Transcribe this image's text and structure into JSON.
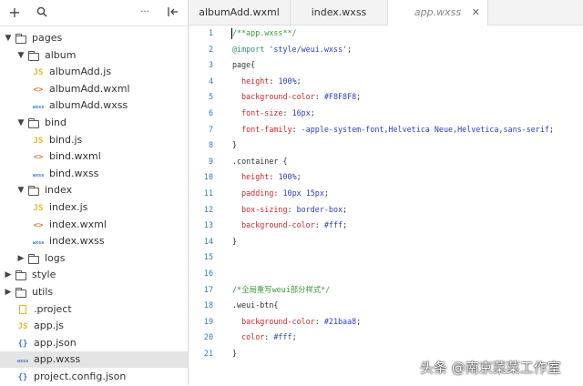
{
  "toolbar": {
    "icons": [
      "plus-icon",
      "search-icon",
      "more-icon",
      "collapse-panel-icon"
    ],
    "plus": "+",
    "more": "···"
  },
  "tree": [
    {
      "label": "pages",
      "type": "folder",
      "expanded": true,
      "depth": 0
    },
    {
      "label": "album",
      "type": "folder",
      "expanded": true,
      "depth": 1
    },
    {
      "label": "albumAdd.js",
      "type": "js",
      "depth": 2
    },
    {
      "label": "albumAdd.wxml",
      "type": "wxml",
      "depth": 2
    },
    {
      "label": "albumAdd.wxss",
      "type": "wxss",
      "depth": 2
    },
    {
      "label": "bind",
      "type": "folder",
      "expanded": true,
      "depth": 1
    },
    {
      "label": "bind.js",
      "type": "js",
      "depth": 2
    },
    {
      "label": "bind.wxml",
      "type": "wxml",
      "depth": 2
    },
    {
      "label": "bind.wxss",
      "type": "wxss",
      "depth": 2
    },
    {
      "label": "index",
      "type": "folder",
      "expanded": true,
      "depth": 1
    },
    {
      "label": "index.js",
      "type": "js",
      "depth": 2
    },
    {
      "label": "index.wxml",
      "type": "wxml",
      "depth": 2
    },
    {
      "label": "index.wxss",
      "type": "wxss",
      "depth": 2
    },
    {
      "label": "logs",
      "type": "folder",
      "expanded": false,
      "depth": 1
    },
    {
      "label": "style",
      "type": "folder",
      "expanded": false,
      "depth": 0
    },
    {
      "label": "utils",
      "type": "folder",
      "expanded": false,
      "depth": 0
    },
    {
      "label": ".project",
      "type": "file",
      "depth": 0
    },
    {
      "label": "app.js",
      "type": "js",
      "depth": 0
    },
    {
      "label": "app.json",
      "type": "json",
      "depth": 0
    },
    {
      "label": "app.wxss",
      "type": "wxss",
      "depth": 0,
      "selected": true
    },
    {
      "label": "project.config.json",
      "type": "json",
      "depth": 0
    }
  ],
  "icon_text": {
    "js": "JS",
    "wxml": "<>",
    "wxss": "wxss",
    "json": "{}"
  },
  "tabs": [
    {
      "label": "albumAdd.wxml",
      "active": false
    },
    {
      "label": "index.wxss",
      "active": false
    },
    {
      "label": "app.wxss",
      "active": true,
      "close": "✕"
    }
  ],
  "editor": {
    "colors": {
      "comment": "#3a9a3a",
      "keyword": "#3c8a7e",
      "property": "#c72a2a",
      "value": "#2d3fb3",
      "string": "#2d3fb3",
      "punct": "#333333",
      "selector": "#333333",
      "line_number": "#2b7bb9"
    },
    "lines": [
      [
        {
          "t": "/**app.wxss**/",
          "c": "comment"
        }
      ],
      [
        {
          "t": "@import",
          "c": "keyword"
        },
        {
          "t": " ",
          "c": "punct"
        },
        {
          "t": "'style/weui.wxss'",
          "c": "string"
        },
        {
          "t": ";",
          "c": "punct"
        }
      ],
      [
        {
          "t": "page{",
          "c": "selector"
        }
      ],
      [
        {
          "t": "  height",
          "c": "property"
        },
        {
          "t": ": ",
          "c": "punct"
        },
        {
          "t": "100%",
          "c": "value"
        },
        {
          "t": ";",
          "c": "punct"
        }
      ],
      [
        {
          "t": "  background-color",
          "c": "property"
        },
        {
          "t": ": ",
          "c": "punct"
        },
        {
          "t": "#F8F8F8",
          "c": "value"
        },
        {
          "t": ";",
          "c": "punct"
        }
      ],
      [
        {
          "t": "  font-size",
          "c": "property"
        },
        {
          "t": ": ",
          "c": "punct"
        },
        {
          "t": "16px",
          "c": "value"
        },
        {
          "t": ";",
          "c": "punct"
        }
      ],
      [
        {
          "t": "  font-family",
          "c": "property"
        },
        {
          "t": ": ",
          "c": "punct"
        },
        {
          "t": "-apple-system-font,Helvetica Neue,Helvetica,sans-serif",
          "c": "value"
        },
        {
          "t": ";",
          "c": "punct"
        }
      ],
      [
        {
          "t": "}",
          "c": "selector"
        }
      ],
      [
        {
          "t": ".container {",
          "c": "selector"
        }
      ],
      [
        {
          "t": "  height",
          "c": "property"
        },
        {
          "t": ": ",
          "c": "punct"
        },
        {
          "t": "100%",
          "c": "value"
        },
        {
          "t": ";",
          "c": "punct"
        }
      ],
      [
        {
          "t": "  padding",
          "c": "property"
        },
        {
          "t": ": ",
          "c": "punct"
        },
        {
          "t": "10px 15px",
          "c": "value"
        },
        {
          "t": ";",
          "c": "punct"
        }
      ],
      [
        {
          "t": "  box-sizing",
          "c": "property"
        },
        {
          "t": ": ",
          "c": "punct"
        },
        {
          "t": "border-box",
          "c": "value"
        },
        {
          "t": ";",
          "c": "punct"
        }
      ],
      [
        {
          "t": "  background-color",
          "c": "property"
        },
        {
          "t": ": ",
          "c": "punct"
        },
        {
          "t": "#fff",
          "c": "value"
        },
        {
          "t": ";",
          "c": "punct"
        }
      ],
      [
        {
          "t": "}",
          "c": "selector"
        }
      ],
      [],
      [],
      [
        {
          "t": "/*全局重写weui部分样式*/",
          "c": "comment"
        }
      ],
      [
        {
          "t": ".weui-btn{",
          "c": "selector"
        }
      ],
      [
        {
          "t": "  background-color",
          "c": "property"
        },
        {
          "t": ": ",
          "c": "punct"
        },
        {
          "t": "#21baa8",
          "c": "value"
        },
        {
          "t": ";",
          "c": "punct"
        }
      ],
      [
        {
          "t": "  color",
          "c": "property"
        },
        {
          "t": ": ",
          "c": "punct"
        },
        {
          "t": "#fff",
          "c": "value"
        },
        {
          "t": ";",
          "c": "punct"
        }
      ],
      [
        {
          "t": "}",
          "c": "selector"
        }
      ]
    ],
    "line_numbers": [
      "1",
      "2",
      "3",
      "4",
      "5",
      "6",
      "7",
      "8",
      "9",
      "10",
      "11",
      "12",
      "13",
      "14",
      "15",
      "16",
      "17",
      "18",
      "19",
      "20",
      "21"
    ]
  },
  "watermark": "头条 @南京菜菜工作室"
}
